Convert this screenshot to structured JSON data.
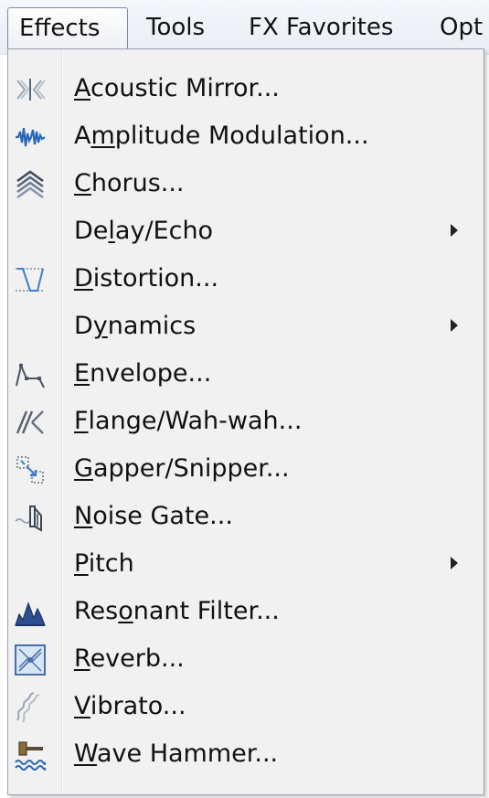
{
  "menubar": {
    "items": [
      {
        "label": "Effects",
        "open": true
      },
      {
        "label": "Tools"
      },
      {
        "label": "FX Favorites"
      },
      {
        "label": "Opt"
      }
    ]
  },
  "effects_menu": {
    "items": [
      {
        "pre": "",
        "mn": "A",
        "post": "coustic Mirror...",
        "icon": "acoustic-mirror-icon"
      },
      {
        "pre": "A",
        "mn": "m",
        "post": "plitude Modulation...",
        "icon": "amplitude-modulation-icon"
      },
      {
        "pre": "",
        "mn": "C",
        "post": "horus...",
        "icon": "chorus-icon"
      },
      {
        "pre": "De",
        "mn": "l",
        "post": "ay/Echo",
        "icon": "",
        "submenu": true
      },
      {
        "pre": "",
        "mn": "D",
        "post": "istortion...",
        "icon": "distortion-icon"
      },
      {
        "pre": "D",
        "mn": "y",
        "post": "namics",
        "icon": "",
        "submenu": true
      },
      {
        "pre": "",
        "mn": "E",
        "post": "nvelope...",
        "icon": "envelope-icon"
      },
      {
        "pre": "",
        "mn": "F",
        "post": "lange/Wah-wah...",
        "icon": "flange-icon"
      },
      {
        "pre": "",
        "mn": "G",
        "post": "apper/Snipper...",
        "icon": "gapper-snipper-icon"
      },
      {
        "pre": "",
        "mn": "N",
        "post": "oise Gate...",
        "icon": "noise-gate-icon"
      },
      {
        "pre": "",
        "mn": "P",
        "post": "itch",
        "icon": "",
        "submenu": true
      },
      {
        "pre": "Res",
        "mn": "o",
        "post": "nant Filter...",
        "icon": "resonant-filter-icon"
      },
      {
        "pre": "",
        "mn": "R",
        "post": "everb...",
        "icon": "reverb-icon"
      },
      {
        "pre": "",
        "mn": "V",
        "post": "ibrato...",
        "icon": "vibrato-icon"
      },
      {
        "pre": "",
        "mn": "W",
        "post": "ave Hammer...",
        "icon": "wave-hammer-icon"
      }
    ]
  }
}
